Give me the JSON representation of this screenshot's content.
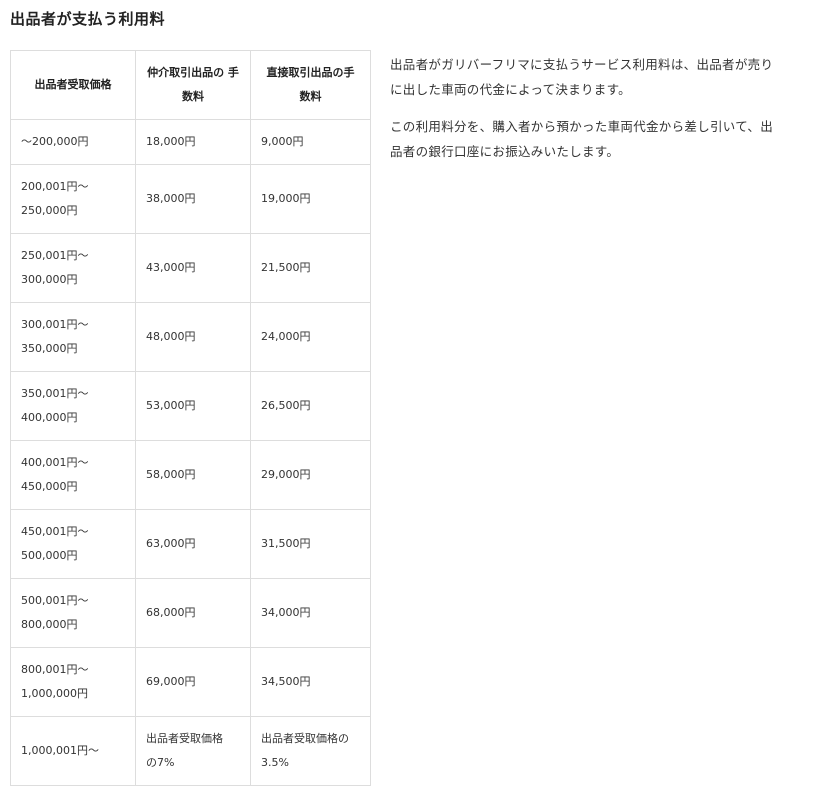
{
  "title": "出品者が支払う利用料",
  "table": {
    "headers": [
      [
        "出品者受取価格"
      ],
      [
        "仲介取引出品の",
        "手数料"
      ],
      [
        "直接取引出品の手",
        "数料"
      ]
    ],
    "rows": [
      {
        "range": [
          "〜200,000円"
        ],
        "broker": [
          "18,000円"
        ],
        "direct": [
          "9,000円"
        ]
      },
      {
        "range": [
          "200,001円〜",
          "250,000円"
        ],
        "broker": [
          "38,000円"
        ],
        "direct": [
          "19,000円"
        ]
      },
      {
        "range": [
          "250,001円〜",
          "300,000円"
        ],
        "broker": [
          "43,000円"
        ],
        "direct": [
          "21,500円"
        ]
      },
      {
        "range": [
          "300,001円〜",
          "350,000円"
        ],
        "broker": [
          "48,000円"
        ],
        "direct": [
          "24,000円"
        ]
      },
      {
        "range": [
          "350,001円〜",
          "400,000円"
        ],
        "broker": [
          "53,000円"
        ],
        "direct": [
          "26,500円"
        ]
      },
      {
        "range": [
          "400,001円〜",
          "450,000円"
        ],
        "broker": [
          "58,000円"
        ],
        "direct": [
          "29,000円"
        ]
      },
      {
        "range": [
          "450,001円〜",
          "500,000円"
        ],
        "broker": [
          "63,000円"
        ],
        "direct": [
          "31,500円"
        ]
      },
      {
        "range": [
          "500,001円〜",
          "800,000円"
        ],
        "broker": [
          "68,000円"
        ],
        "direct": [
          "34,000円"
        ]
      },
      {
        "range": [
          "800,001円〜",
          "1,000,000円"
        ],
        "broker": [
          "69,000円"
        ],
        "direct": [
          "34,500円"
        ]
      },
      {
        "range": [
          "1,000,001円〜"
        ],
        "broker": [
          "出品者受取価格",
          "の7%"
        ],
        "direct": [
          "出品者受取価格の",
          "3.5%"
        ]
      }
    ]
  },
  "description": {
    "paragraphs": [
      [
        "出品者がガリバーフリマに支払うサービス利用料は、出品者が売り",
        "に出した車両の代金によって決まります。"
      ],
      [
        "この利用料分を、購入者から預かった車両代金から差し引いて、出",
        "品者の銀行口座にお振込みいたします。"
      ]
    ]
  }
}
